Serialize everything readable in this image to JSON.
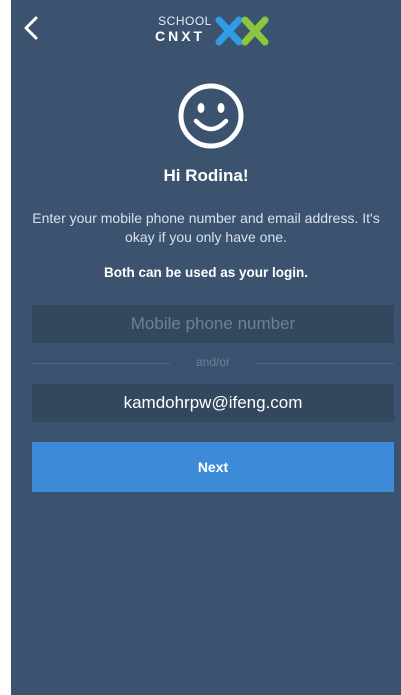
{
  "header": {
    "back_icon": "chevron-left-icon",
    "logo": {
      "line1": "SCHOOL",
      "line2": "CNXT",
      "mark_colors": [
        "#2f9de6",
        "#8cc63f"
      ]
    }
  },
  "main": {
    "avatar_icon": "smiley-face-icon",
    "greeting": "Hi Rodina!",
    "instructions": "Enter your mobile phone number and email address. It's okay if you only have one.",
    "login_note": "Both can be used as your login.",
    "phone": {
      "placeholder": "Mobile phone number",
      "value": ""
    },
    "separator": "and/or",
    "email": {
      "placeholder": "",
      "value": "kamdohrpw@ifeng.com"
    },
    "next_label": "Next"
  },
  "colors": {
    "background": "#3b536f",
    "field_background": "#33485f",
    "primary_button": "#3d8ad8"
  }
}
